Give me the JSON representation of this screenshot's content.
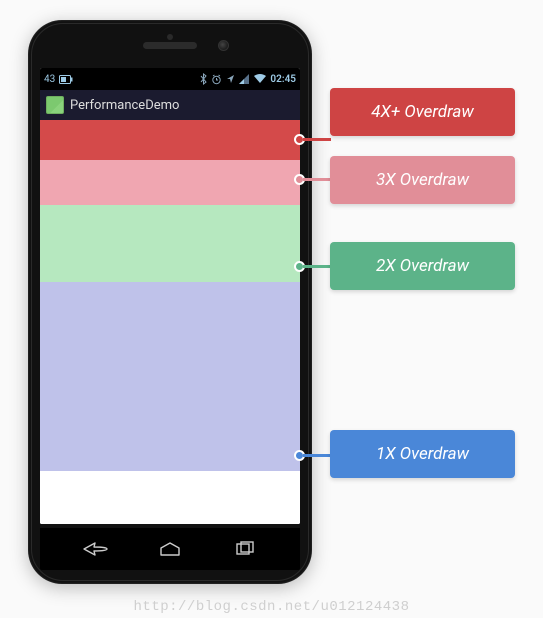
{
  "statusbar": {
    "battery_level": "43",
    "clock": "02:45"
  },
  "titlebar": {
    "app_name": "PerformanceDemo"
  },
  "overdraw": {
    "red": {
      "label": "4X+ Overdraw",
      "color": "#d44a4a",
      "callout_color": "#ce4444"
    },
    "pink": {
      "label": "3X Overdraw",
      "color": "#f0a6b1",
      "callout_color": "#e18e98"
    },
    "green": {
      "label": "2X Overdraw",
      "color": "#b6e8bf",
      "callout_color": "#5cb389"
    },
    "blue": {
      "label": "1X Overdraw",
      "color": "#bfc2ea",
      "callout_color": "#4a87d8"
    }
  },
  "watermark": "http://blog.csdn.net/u012124438"
}
